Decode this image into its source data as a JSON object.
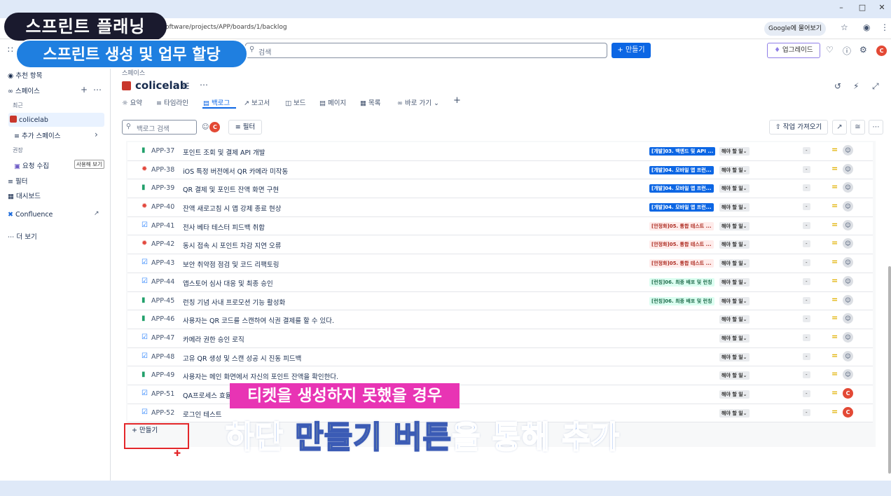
{
  "browser": {
    "url": "oftware/projects/APP/boards/1/backlog",
    "google_chip": "Google에 물어보기"
  },
  "topbar": {
    "search_placeholder": "검색",
    "create_label": "+ 만들기",
    "upgrade_label": "업그레이드",
    "avatar": "C"
  },
  "sidebar": {
    "recommended": "추천 항목",
    "spaces": "스페이스",
    "recent": "최근",
    "project": "colicelab",
    "more_spaces": "추가 스페이스",
    "recommended_section": "권장",
    "request_intake": "요청 수집",
    "try_tag": "사용해 보기",
    "filters": "필터",
    "dashboards": "대시보드",
    "confluence": "Confluence",
    "more": "더 보기"
  },
  "page": {
    "breadcrumb": "스페이스",
    "title": "colicelab",
    "tabs": [
      "요약",
      "타임라인",
      "백로그",
      "보고서",
      "보드",
      "페이지",
      "목록",
      "바로 가기"
    ],
    "backlog_search_placeholder": "백로그 검색",
    "filter_label": "필터",
    "import_label": "작업 가져오기",
    "create_row_label": "만들기"
  },
  "colors": {
    "epic_dev_bg": "#0c66e4",
    "epic_dev_fg": "#ffffff",
    "epic_stab_bg": "#ffeceb",
    "epic_stab_fg": "#ae2e24",
    "epic_launch_bg": "#dcfff1",
    "epic_launch_fg": "#216e4e"
  },
  "issues": [
    {
      "type": "story",
      "key": "APP-37",
      "summary": "포인트 조회 및 결제 API 개발",
      "epic": "[개발]03. 백엔드 및 API ...",
      "epic_kind": "dev",
      "status": "해야 할 일",
      "points": "-",
      "assignee": ""
    },
    {
      "type": "bug",
      "key": "APP-38",
      "summary": "iOS 특정 버전에서 QR 카메라 미작동",
      "epic": "[개발]04. 모바일 앱 프런...",
      "epic_kind": "dev",
      "status": "해야 할 일",
      "points": "-",
      "assignee": ""
    },
    {
      "type": "story",
      "key": "APP-39",
      "summary": "QR 결제 및 포인트 잔액 화면 구현",
      "epic": "[개발]04. 모바일 앱 프런...",
      "epic_kind": "dev",
      "status": "해야 할 일",
      "points": "-",
      "assignee": ""
    },
    {
      "type": "bug",
      "key": "APP-40",
      "summary": "잔액 새로고침 시 앱 강제 종료 현상",
      "epic": "[개발]04. 모바일 앱 프런...",
      "epic_kind": "dev",
      "status": "해야 할 일",
      "points": "-",
      "assignee": ""
    },
    {
      "type": "task",
      "key": "APP-41",
      "summary": "전사 베타 테스터 피드백 취합",
      "epic": "[안정화]05. 통합 테스트 ...",
      "epic_kind": "stab",
      "status": "해야 할 일",
      "points": "-",
      "assignee": ""
    },
    {
      "type": "bug",
      "key": "APP-42",
      "summary": "동시 접속 시 포인트 차감 지연 오류",
      "epic": "[안정화]05. 통합 테스트 ...",
      "epic_kind": "stab",
      "status": "해야 할 일",
      "points": "-",
      "assignee": ""
    },
    {
      "type": "task",
      "key": "APP-43",
      "summary": "보안 취약점 점검 및 코드 리팩토링",
      "epic": "[안정화]05. 통합 테스트 ...",
      "epic_kind": "stab",
      "status": "해야 할 일",
      "points": "-",
      "assignee": ""
    },
    {
      "type": "task",
      "key": "APP-44",
      "summary": "앱스토어 심사 대응 및 최종 승인",
      "epic": "[런칭]06. 최종 배포 및 런칭",
      "epic_kind": "launch",
      "status": "해야 할 일",
      "points": "-",
      "assignee": ""
    },
    {
      "type": "story",
      "key": "APP-45",
      "summary": "런칭 기념 사내 프로모션 기능 활성화",
      "epic": "[런칭]06. 최종 배포 및 런칭",
      "epic_kind": "launch",
      "status": "해야 할 일",
      "points": "-",
      "assignee": ""
    },
    {
      "type": "story",
      "key": "APP-46",
      "summary": "사용자는 QR 코드를 스캔하여 식권 결제를 할 수 있다.",
      "epic": "",
      "epic_kind": "",
      "status": "해야 할 일",
      "points": "-",
      "assignee": ""
    },
    {
      "type": "task",
      "key": "APP-47",
      "summary": "카메라 권한 승인 로직",
      "epic": "",
      "epic_kind": "",
      "status": "해야 할 일",
      "points": "-",
      "assignee": ""
    },
    {
      "type": "task",
      "key": "APP-48",
      "summary": "고유 QR 생성 및 스캔 성공 시 진동 피드백",
      "epic": "",
      "epic_kind": "",
      "status": "해야 할 일",
      "points": "-",
      "assignee": ""
    },
    {
      "type": "story",
      "key": "APP-49",
      "summary": "사용자는 메인 화면에서 자신의 포인트 잔액을 확인한다.",
      "epic": "",
      "epic_kind": "",
      "status": "해야 할 일",
      "points": "-",
      "assignee": ""
    },
    {
      "type": "task",
      "key": "APP-51",
      "summary": "QA프로세스 효율",
      "epic": "",
      "epic_kind": "",
      "status": "해야 할 일",
      "points": "-",
      "assignee": "C"
    },
    {
      "type": "task",
      "key": "APP-52",
      "summary": "로그인 테스트",
      "epic": "",
      "epic_kind": "",
      "status": "해야 할 일",
      "points": "-",
      "assignee": "C"
    }
  ],
  "overlay": {
    "badge1": "스프린트 플래닝",
    "badge2": "스프린트 생성 및 업무 할당",
    "caption1": "티켓을 생성하지 못했을 경우",
    "caption2_a": "하단 ",
    "caption2_b": "만들기 버튼",
    "caption2_c": "을 통해 추가"
  }
}
